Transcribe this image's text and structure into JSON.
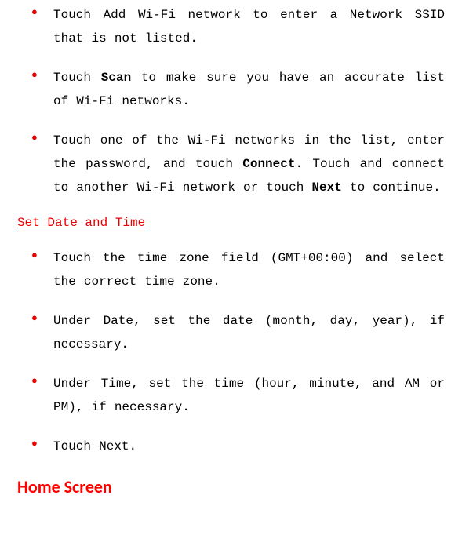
{
  "wifi": {
    "items": [
      {
        "pre": "Touch Add Wi-Fi network to enter a Network SSID that is not listed."
      },
      {
        "pre": "Touch ",
        "b1": "Scan",
        "post1": " to make sure you have an accurate list of Wi-Fi networks."
      },
      {
        "pre": "Touch one of the Wi-Fi networks in the list, enter the password, and touch ",
        "b1": "Connect",
        "post1": ". Touch and connect to another Wi-Fi network or touch ",
        "b2": "Next",
        "post2": " to continue."
      }
    ]
  },
  "datetime": {
    "heading": "Set Date and Time",
    "items": [
      {
        "text": "Touch the time zone field (GMT+00:00) and select the correct time zone."
      },
      {
        "text": "Under Date, set the date (month, day, year), if necessary."
      },
      {
        "text": "Under Time, set the time (hour, minute, and AM or PM), if necessary."
      },
      {
        "text": "Touch Next."
      }
    ]
  },
  "home": {
    "heading": "Home Screen"
  },
  "bullet_glyph": "●"
}
